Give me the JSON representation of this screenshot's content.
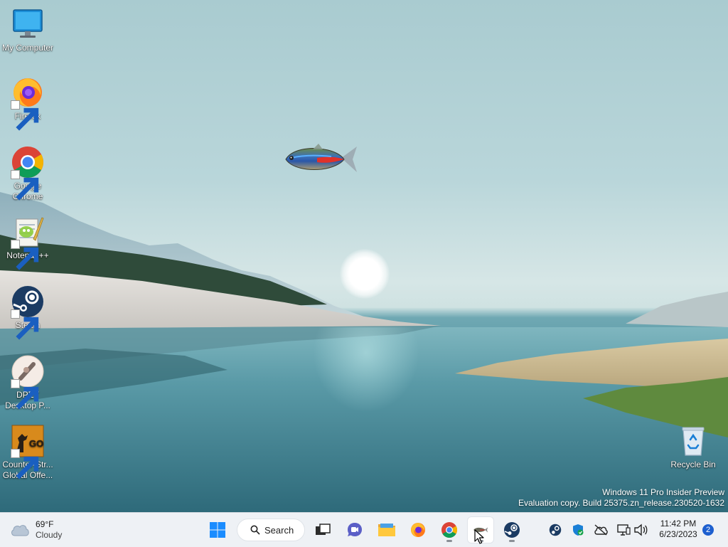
{
  "desktop": {
    "icons": [
      {
        "label": "My Computer",
        "icon": "monitor-icon"
      },
      {
        "label": "Firefox",
        "icon": "firefox-icon"
      },
      {
        "label": "Google Chrome",
        "icon": "chrome-icon"
      },
      {
        "label": "Notepad++",
        "icon": "notepadpp-icon"
      },
      {
        "label": "Steam",
        "icon": "steam-icon"
      },
      {
        "label": "DPET Desktop P...",
        "icon": "dpet-icon"
      },
      {
        "label": "Counter-Str... Global Offe...",
        "icon": "csgo-icon"
      }
    ],
    "recycle_bin": {
      "label": "Recycle Bin",
      "icon": "recycle-bin-icon"
    },
    "watermark": {
      "line1": "Windows 11 Pro Insider Preview",
      "line2": "Evaluation copy. Build 25375.zn_release.230520-1632"
    }
  },
  "taskbar": {
    "weather": {
      "temp": "69°F",
      "condition": "Cloudy",
      "icon": "cloud-icon"
    },
    "search_label": "Search",
    "apps": [
      {
        "name": "start",
        "icon": "windows-start-icon"
      },
      {
        "name": "task-view",
        "icon": "task-view-icon"
      },
      {
        "name": "teams-chat",
        "icon": "teams-chat-icon"
      },
      {
        "name": "file-explorer",
        "icon": "folder-icon"
      },
      {
        "name": "firefox",
        "icon": "firefox-icon"
      },
      {
        "name": "chrome",
        "icon": "chrome-icon",
        "running": true
      },
      {
        "name": "dpet",
        "icon": "fish-icon",
        "running": true,
        "active": true
      },
      {
        "name": "steam",
        "icon": "steam-icon",
        "running": true
      }
    ],
    "tray": [
      "steam-tray-icon",
      "defender-icon",
      "onedrive-offline-icon",
      "network-icon",
      "volume-icon"
    ],
    "clock": {
      "time": "11:42 PM",
      "date": "6/23/2023"
    },
    "notifications": "2"
  },
  "colors": {
    "taskbar_bg": "#eef1f5",
    "accent": "#1d5fcf"
  }
}
